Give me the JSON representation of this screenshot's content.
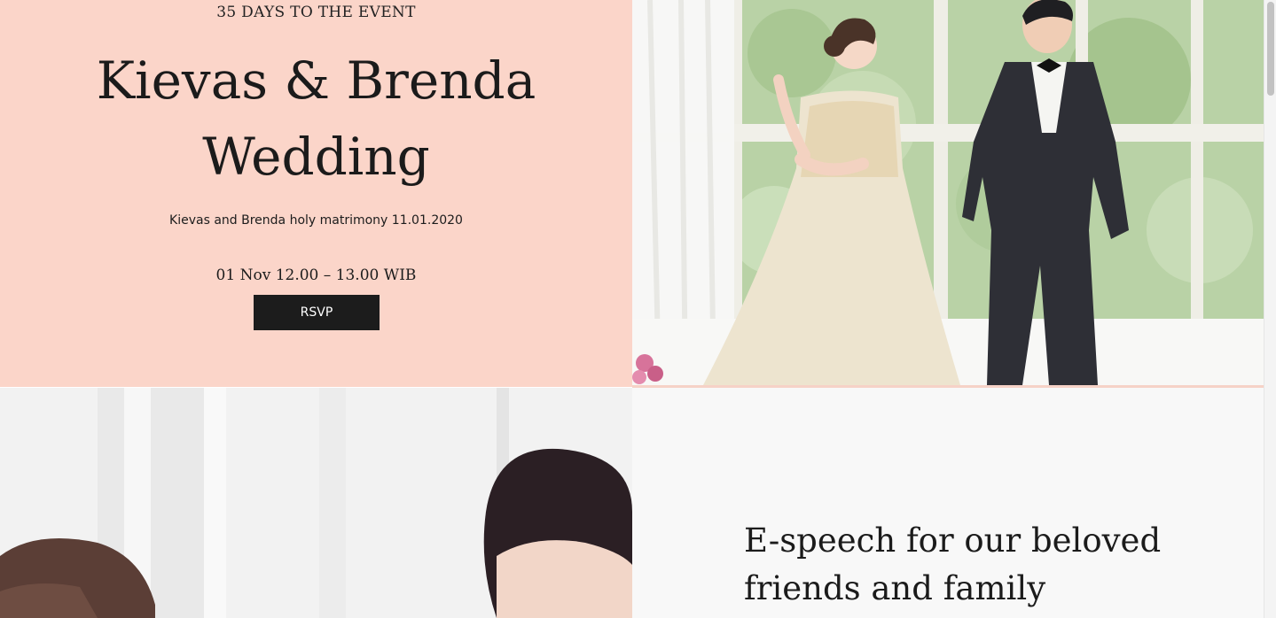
{
  "hero": {
    "countdown": "35 DAYS TO THE EVENT",
    "title_line1": "Kievas & Brenda",
    "title_line2": "Wedding",
    "subtitle": "Kievas and Brenda holy matrimony 11.01.2020",
    "event_time": "01 Nov 12.00 – 13.00 WIB",
    "rsvp_label": "RSVP",
    "background_color": "#fbd5c9"
  },
  "speech": {
    "heading_line1": "E-speech for our beloved",
    "heading_line2": "friends and family"
  },
  "colors": {
    "button": "#1c1c1c",
    "text": "#1b1b1b"
  }
}
